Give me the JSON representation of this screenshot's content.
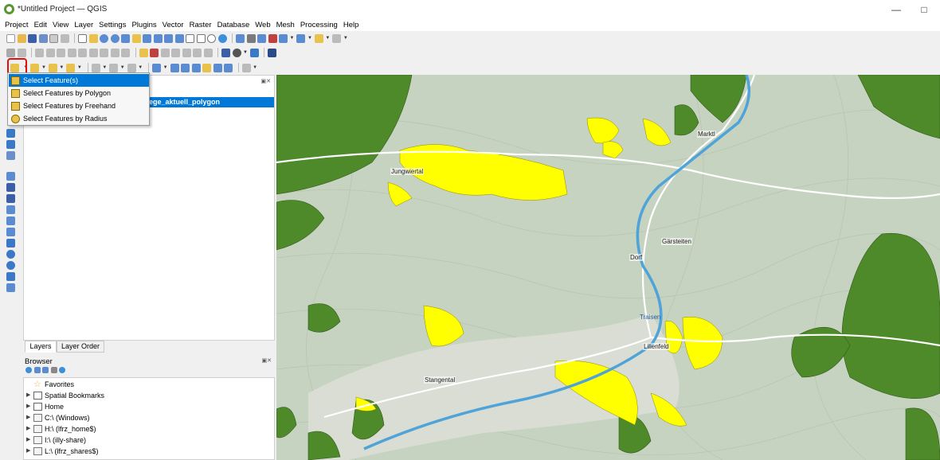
{
  "window": {
    "title": "*Untitled Project — QGIS"
  },
  "menu": [
    "Project",
    "Edit",
    "View",
    "Layer",
    "Settings",
    "Plugins",
    "Vector",
    "Raster",
    "Database",
    "Web",
    "Mesh",
    "Processing",
    "Help"
  ],
  "layers_panel": {
    "selected_layer_label": "nlaege_aktuell_polygon"
  },
  "panel_tabs": {
    "layers": "Layers",
    "layer_order": "Layer Order"
  },
  "browser": {
    "title": "Browser",
    "items": [
      {
        "label": "Favorites",
        "icon": "star-icon"
      },
      {
        "label": "Spatial Bookmarks",
        "icon": "bookmarks-icon"
      },
      {
        "label": "Home",
        "icon": "home-icon"
      },
      {
        "label": "C:\\ (Windows)",
        "icon": "drive-icon"
      },
      {
        "label": "H:\\ (lfrz_home$)",
        "icon": "drive-icon"
      },
      {
        "label": "I:\\ (illy-share)",
        "icon": "drive-icon"
      },
      {
        "label": "L:\\ (lfrz_shares$)",
        "icon": "drive-icon"
      }
    ]
  },
  "select_dropdown": {
    "items": [
      {
        "label": "Select Feature(s)",
        "selected": true
      },
      {
        "label": "Select Features by Polygon",
        "selected": false
      },
      {
        "label": "Select Features by Freehand",
        "selected": false
      },
      {
        "label": "Select Features by Radius",
        "selected": false
      }
    ]
  },
  "map": {
    "place_labels": [
      "Jungwiertal",
      "Dorf",
      "Gärsteiten",
      "Lilienfeld",
      "Stangental",
      "Traisen",
      "Marktl"
    ],
    "colors": {
      "forest": "#4f8a2a",
      "selected_parcels": "#ffff00",
      "hillshade": "#c7d3c1",
      "river": "#4fa3d8",
      "roads": "#ffffff"
    }
  }
}
